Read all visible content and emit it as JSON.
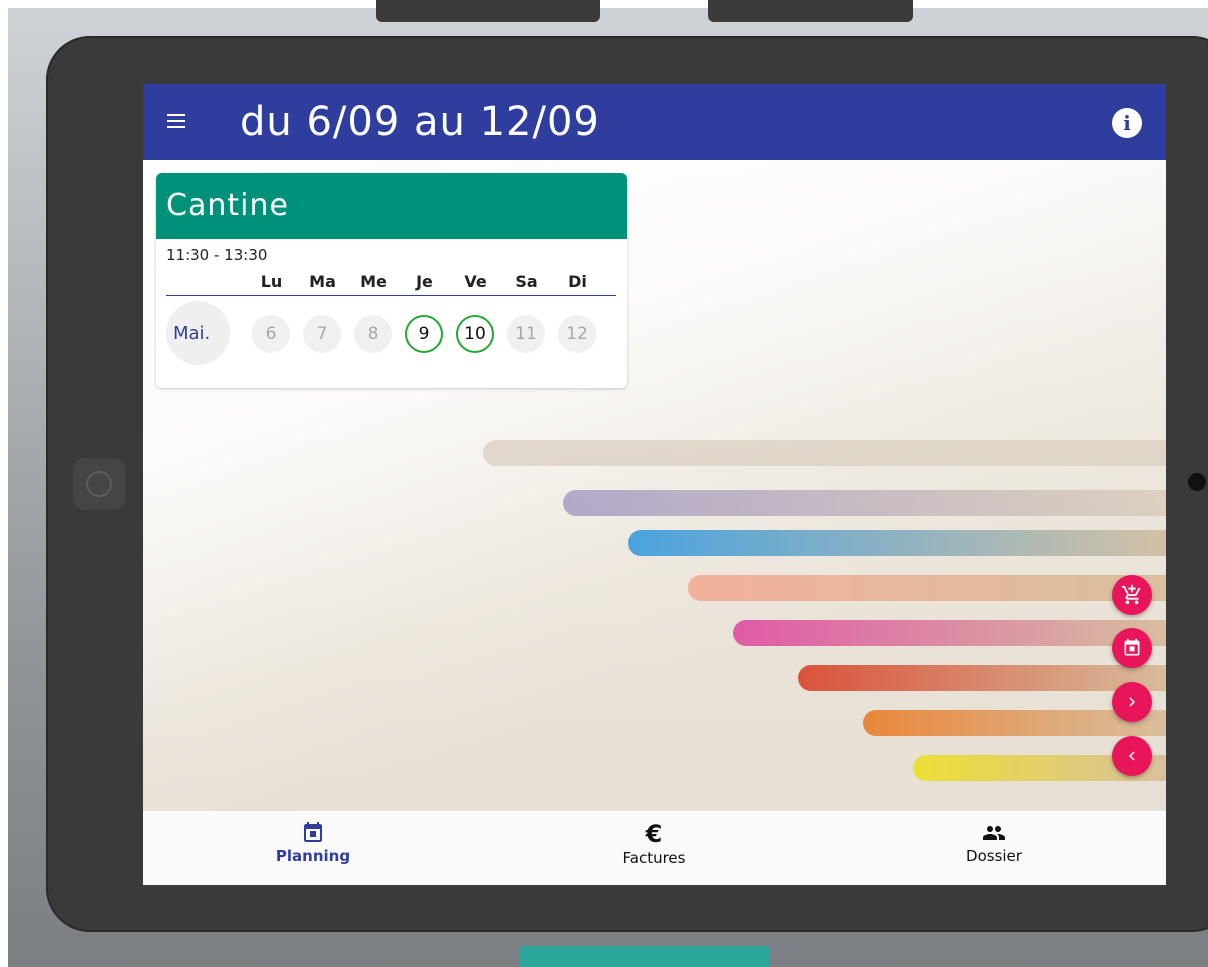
{
  "header": {
    "title": "du 6/09 au 12/09"
  },
  "card": {
    "title": "Cantine",
    "time": "11:30 - 13:30",
    "day_headers": [
      "Lu",
      "Ma",
      "Me",
      "Je",
      "Ve",
      "Sa",
      "Di"
    ],
    "row_label": "Mai.",
    "days": [
      {
        "num": "6",
        "booked": false
      },
      {
        "num": "7",
        "booked": false
      },
      {
        "num": "8",
        "booked": false
      },
      {
        "num": "9",
        "booked": true
      },
      {
        "num": "10",
        "booked": true
      },
      {
        "num": "11",
        "booked": false
      },
      {
        "num": "12",
        "booked": false
      }
    ]
  },
  "fabs": [
    {
      "icon": "cart-add-icon"
    },
    {
      "icon": "calendar-icon"
    },
    {
      "icon": "chevron-right-icon"
    },
    {
      "icon": "chevron-left-icon"
    }
  ],
  "nav": {
    "items": [
      {
        "label": "Planning",
        "icon": "calendar-icon",
        "active": true
      },
      {
        "label": "Factures",
        "icon": "euro-icon",
        "active": false
      },
      {
        "label": "Dossier",
        "icon": "people-icon",
        "active": false
      }
    ]
  },
  "colors": {
    "primary": "#2f3e9e",
    "card_header": "#00917a",
    "accent": "#e8155a",
    "booked_ring": "#27a637"
  }
}
